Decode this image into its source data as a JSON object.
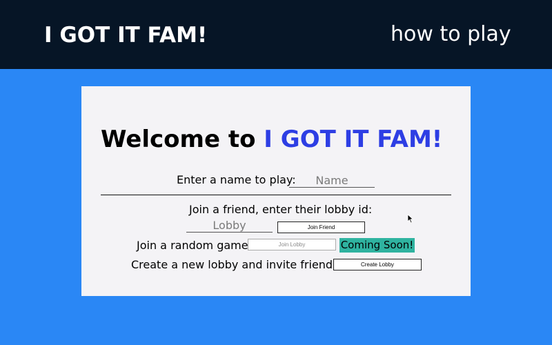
{
  "header": {
    "brand": "I GOT IT FAM!",
    "how_to_play": "how to play"
  },
  "welcome": {
    "prefix": "Welcome to ",
    "accent": "I GOT IT FAM!"
  },
  "name_section": {
    "label": "Enter a name to play:",
    "input_placeholder": "Name",
    "input_value": ""
  },
  "join_friend": {
    "label": "Join a friend, enter their lobby id:",
    "input_placeholder": "Lobby",
    "input_value": "",
    "button_label": "Join Friend"
  },
  "random_game": {
    "label": "Join a random game:",
    "button_label": "Join Lobby",
    "badge": "Coming Soon!"
  },
  "create_lobby": {
    "label": "Create a new lobby and invite friends:",
    "button_label": "Create Lobby"
  },
  "colors": {
    "background": "#2a87f5",
    "header_bg": "#061526",
    "card_bg": "#f4f3f6",
    "accent": "#2d3ee4",
    "badge_bg": "#2fb3a0"
  }
}
